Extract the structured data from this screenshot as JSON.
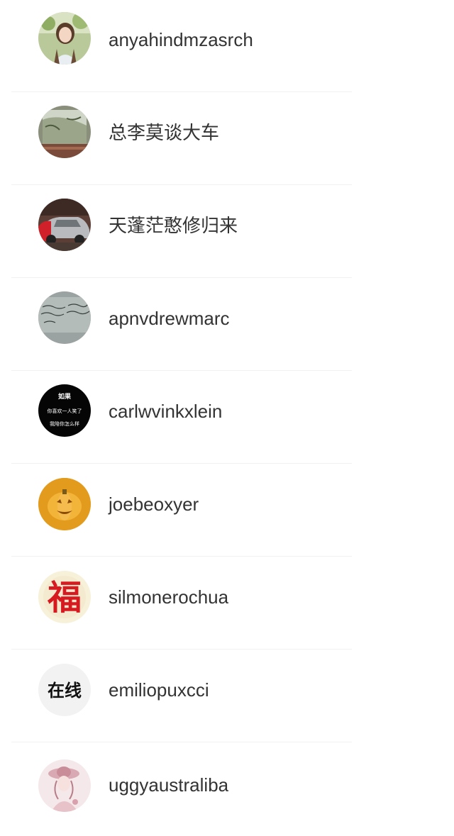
{
  "users": [
    {
      "name": "anyahindmzasrch",
      "avatar": "photo-avatar-girl"
    },
    {
      "name": "总李莫谈大车",
      "avatar": "photo-avatar-window"
    },
    {
      "name": "天蓬茫憨修归来",
      "avatar": "photo-avatar-car"
    },
    {
      "name": "apnvdrewmarc",
      "avatar": "photo-avatar-whiteboard"
    },
    {
      "name": "carlwvinkxlein",
      "avatar": "text-avatar-black",
      "avatar_text": [
        "如果",
        "你喜欢一人笑了",
        "我陪你怎么样"
      ]
    },
    {
      "name": "joebeoxyer",
      "avatar": "pumpkin-avatar"
    },
    {
      "name": "silmonerochua",
      "avatar": "fu-character-avatar",
      "avatar_text": "福"
    },
    {
      "name": "emiliopuxcci",
      "avatar": "text-avatar-grey",
      "avatar_text": "在线"
    },
    {
      "name": "uggyaustraliba",
      "avatar": "illustration-avatar-lady"
    }
  ]
}
